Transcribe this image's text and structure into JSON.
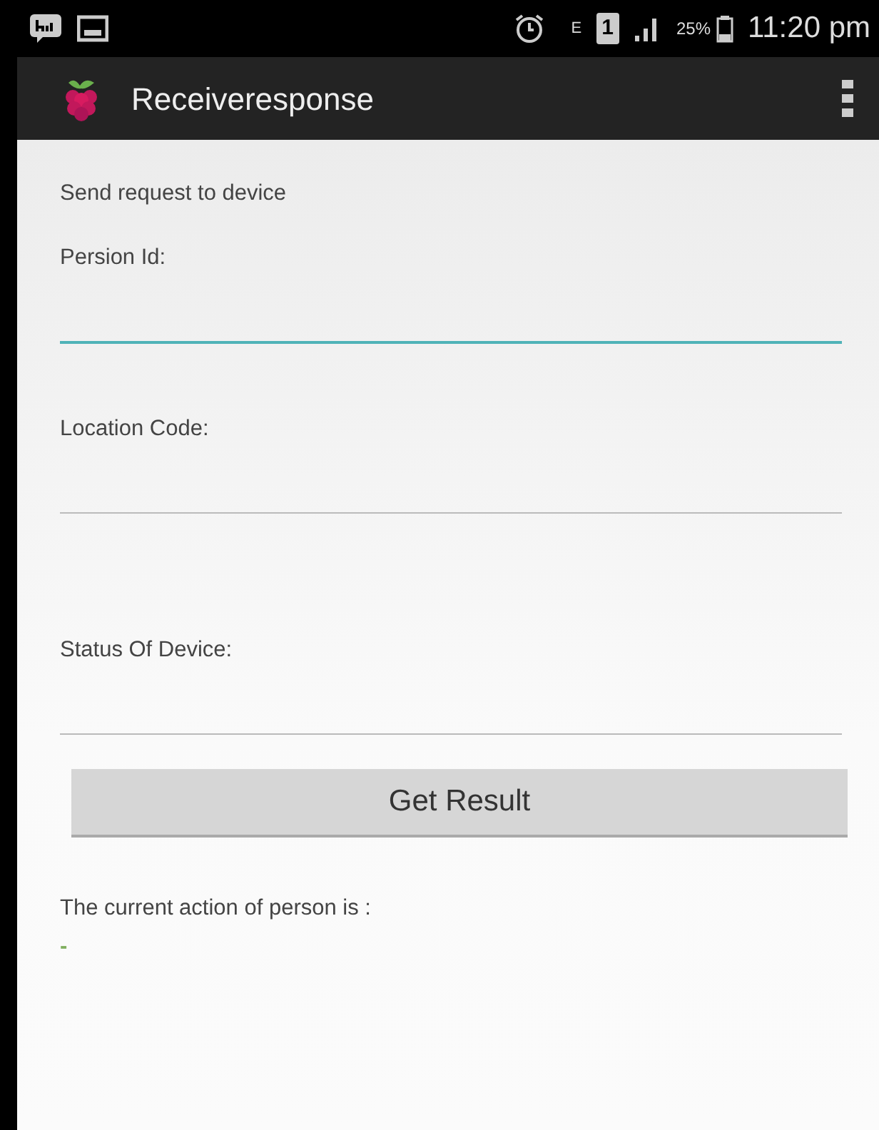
{
  "status_bar": {
    "network_type": "E",
    "sim_slot": "1",
    "battery_percent": "25%",
    "time": "11:20 pm"
  },
  "app_bar": {
    "title": "Receiveresponse"
  },
  "heading": "Send request to device",
  "fields": [
    {
      "label": "Persion Id:",
      "focused": true
    },
    {
      "label": "Location Code:",
      "focused": false
    },
    {
      "label": "Status Of Device:",
      "focused": false
    }
  ],
  "button": "Get Result",
  "result_label": "The current action of person is :",
  "result_value": "-"
}
